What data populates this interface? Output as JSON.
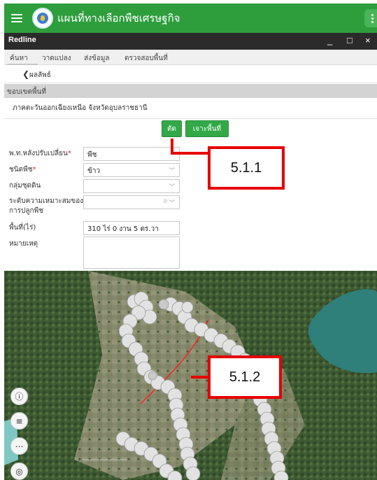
{
  "appbar": {
    "title": "แผนที่ทางเลือกพืชเศรษฐกิจ",
    "menu_icon": "hamburger-menu-icon",
    "logo": "department-logo",
    "overflow_icon": "more-vertical-icon"
  },
  "window": {
    "title": "Redline",
    "minimize": "_",
    "maximize": "□",
    "close": "×"
  },
  "tabs": [
    {
      "label": "ค้นหา"
    },
    {
      "label": "วาดแปลง"
    },
    {
      "label": "ส่งข้อมูล"
    },
    {
      "label": "ตรวจสอบพื้นที่"
    }
  ],
  "subnav": {
    "back_icon": "chevron-left-icon",
    "back_label": "ผลลัพธ์"
  },
  "section": {
    "title": "ขอบเขตพื้นที่",
    "region": "ภาคตะวันออกเฉียงเหนือ จังหวัดอุบลราชธานี"
  },
  "actions": {
    "cut_label": "ตัด",
    "clip_label": "เจาะพื้นที่"
  },
  "form": {
    "change_label": "พ.ท.หลังปรับเปลี่ยน",
    "change_value": "พืช",
    "crop_type_label": "ชนิดพืช",
    "crop_type_value": "ข้าว",
    "soil_group_label": "กลุ่มชุดดิน",
    "soil_group_value": "",
    "suitability_label_1": "ระดับความเหมาะสมของ",
    "suitability_label_2": "การปลูกพืช",
    "suitability_value": "",
    "area_label": "พื้นที่(ไร่)",
    "area_value": "310 ไร่ 0 งาน 5 ตร.วา",
    "note_label": "หมายเหตุ",
    "note_value": ""
  },
  "callouts": {
    "first": "5.1.1",
    "second": "5.1.2"
  },
  "map_controls": [
    {
      "icon": "info-icon",
      "glyph": "ⓘ"
    },
    {
      "icon": "layers-icon",
      "glyph": "≡"
    },
    {
      "icon": "more-horizontal-icon",
      "glyph": "⋯"
    },
    {
      "icon": "locate-icon",
      "glyph": "◎"
    }
  ],
  "colors": {
    "appbar": "#2e9e3c",
    "button": "#32a847",
    "callout": "#e60000",
    "required": "#d32f2f",
    "cut_line": "#ff2020"
  }
}
